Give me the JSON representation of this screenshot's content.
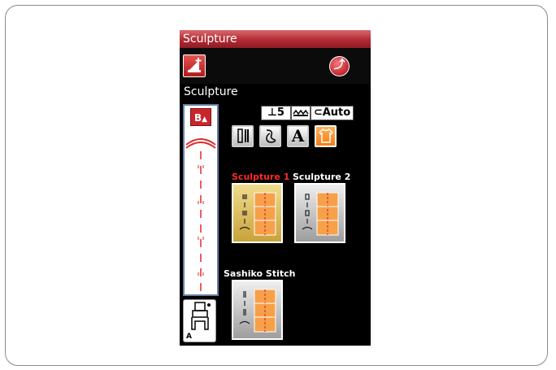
{
  "window": {
    "title": "Sculpture"
  },
  "section": {
    "label": "Sculpture"
  },
  "preview": {
    "badge": "B"
  },
  "info": {
    "presser_height": "5",
    "tension": "Auto"
  },
  "categories": [
    {
      "icon": "utility-stitch-icon",
      "active": false
    },
    {
      "icon": "decorative-stitch-icon",
      "active": false
    },
    {
      "icon": "letter-a-icon",
      "glyph": "A",
      "active": false
    },
    {
      "icon": "garment-icon",
      "active": true
    }
  ],
  "stitches": [
    {
      "label": "Sculpture 1",
      "selected": true
    },
    {
      "label": "Sculpture 2",
      "selected": false
    },
    {
      "label": "Sashiko Stitch",
      "selected": false
    }
  ],
  "foot": {
    "letter": "A"
  },
  "colors": {
    "accent": "#c8262d",
    "selected_label": "#ff2a2a",
    "active_category": "#f39226"
  }
}
